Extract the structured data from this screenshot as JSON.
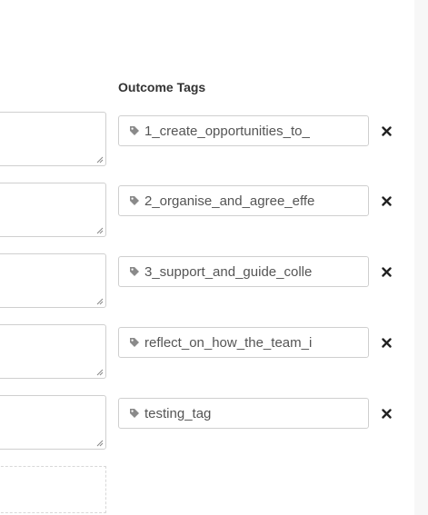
{
  "header": {
    "outcome_tags_label": "Outcome Tags"
  },
  "colors": {
    "text": "#555555",
    "heading": "#333333",
    "border": "#cfcfcf",
    "remove_icon": "#222222"
  },
  "icons": {
    "tag": "tag-icon",
    "remove": "close-icon",
    "resize": "resize-grip-icon"
  },
  "rows": [
    {
      "tag": "1_create_opportunities_to_"
    },
    {
      "tag": "2_organise_and_agree_effe"
    },
    {
      "tag": "3_support_and_guide_colle"
    },
    {
      "tag": "reflect_on_how_the_team_i"
    },
    {
      "tag": "testing_tag"
    }
  ]
}
